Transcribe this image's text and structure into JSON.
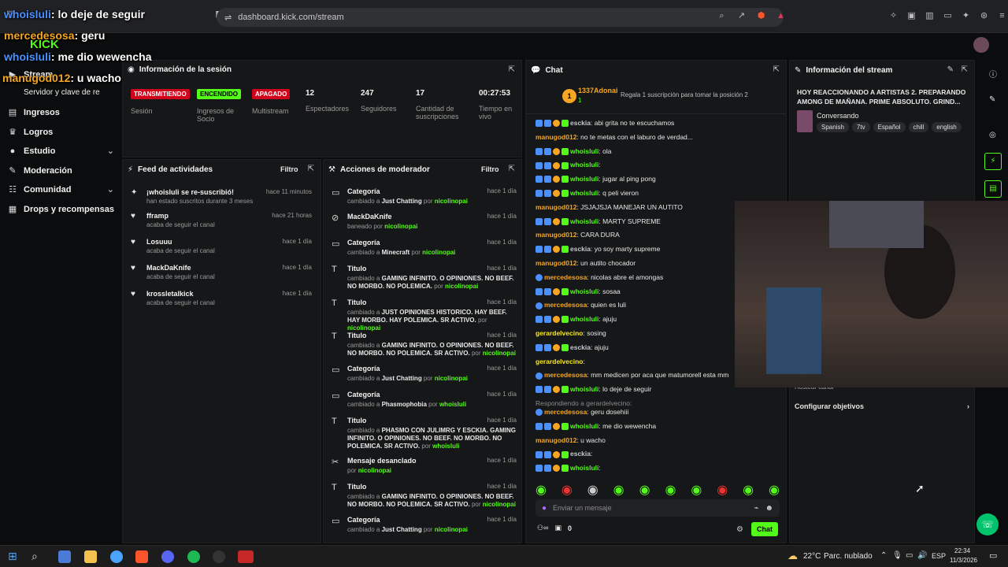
{
  "browser": {
    "url": "dashboard.kick.com/stream"
  },
  "overlay": {
    "lines": [
      {
        "user": "whoisluli",
        "text": ": lo deje de seguir"
      },
      {
        "user": "mercedesosa",
        "text": ": geru"
      },
      {
        "user": "whoisluli",
        "text": ": me dio wewencha"
      },
      {
        "user": "manugod012",
        "text": ": u wacho"
      }
    ],
    "logo": "KICK"
  },
  "nav": {
    "items": [
      {
        "label": "Stream"
      },
      {
        "label": "Servidor y clave de re"
      },
      {
        "label": "Ingresos"
      },
      {
        "label": "Logros"
      },
      {
        "label": "Estudio"
      },
      {
        "label": "Moderación"
      },
      {
        "label": "Comunidad"
      },
      {
        "label": "Drops y recompensas"
      }
    ]
  },
  "session": {
    "title": "Información de la sesión",
    "status": [
      {
        "badge": "TRANSMITIENDO",
        "label": "Sesión",
        "color": "#d0021b"
      },
      {
        "badge": "ENCENDIDO",
        "label": "Ingresos de Socio",
        "color": "#53fc18"
      },
      {
        "badge": "APAGADO",
        "label": "Multistream",
        "color": "#d0021b"
      }
    ],
    "stats": [
      {
        "value": "12",
        "label": "Espectadores"
      },
      {
        "value": "247",
        "label": "Seguidores"
      },
      {
        "value": "17",
        "label": "Cantidad de suscripciones"
      },
      {
        "value": "00:27:53",
        "label": "Tiempo en vivo"
      }
    ]
  },
  "feed": {
    "title": "Feed de actividades",
    "filter": "Filtro",
    "items": [
      {
        "name": "¡whoisluli se re-suscribió!",
        "sub": "han estado suscritos durante 3 meses",
        "time": "hace 11 minutos"
      },
      {
        "name": "fframp",
        "sub": "acaba de seguir el canal",
        "time": "hace 21 horas"
      },
      {
        "name": "Losuuu",
        "sub": "acaba de seguir el canal",
        "time": "hace 1 día"
      },
      {
        "name": "MackDaKnife",
        "sub": "acaba de seguir el canal",
        "time": "hace 1 día"
      },
      {
        "name": "krossletalkick",
        "sub": "acaba de seguir el canal",
        "time": "hace 1 día"
      }
    ]
  },
  "mod": {
    "title": "Acciones de moderador",
    "filter": "Filtro",
    "items": [
      {
        "title": "Categoría",
        "pre": "cambiado a ",
        "val": "Just Chatting",
        "post": " por ",
        "by": "nicolinopai",
        "time": "hace 1 día"
      },
      {
        "title": "MackDaKnife",
        "pre": "baneado por ",
        "val": "",
        "post": "",
        "by": "nicolinopai",
        "time": "hace 1 día"
      },
      {
        "title": "Categoría",
        "pre": "cambiado a ",
        "val": "Minecraft",
        "post": " por ",
        "by": "nicolinopai",
        "time": "hace 1 día"
      },
      {
        "title": "Titulo",
        "pre": "cambiado a ",
        "val": "GAMING INFINITO. O OPINIONES. NO BEEF. NO MORBO. NO POLEMICA.",
        "post": " por ",
        "by": "nicolinopai",
        "time": "hace 1 día"
      },
      {
        "title": "Titulo",
        "pre": "cambiado a ",
        "val": "JUST OPINIONES HISTORICO. HAY BEEF. HAY MORBO. HAY POLEMICA. SR ACTIVO.",
        "post": " por ",
        "by": "nicolinopai",
        "time": "hace 1 día"
      },
      {
        "title": "Titulo",
        "pre": "cambiado a ",
        "val": "GAMING INFINITO. O OPINIONES. NO BEEF. NO MORBO. NO POLEMICA. SR ACTIVO.",
        "post": " por ",
        "by": "nicolinopai",
        "time": "hace 1 día"
      },
      {
        "title": "Categoría",
        "pre": "cambiado a ",
        "val": "Just Chatting",
        "post": " por ",
        "by": "nicolinopai",
        "time": "hace 1 día"
      },
      {
        "title": "Categoría",
        "pre": "cambiado a ",
        "val": "Phasmophobia",
        "post": " por ",
        "by": "whoisluli",
        "time": "hace 1 día"
      },
      {
        "title": "Titulo",
        "pre": "cambiado a ",
        "val": "PHASMO CON JULIMRG Y ESCKIA. GAMING INFINITO. O OPINIONES. NO BEEF. NO MORBO. NO POLEMICA. SR ACTIVO.",
        "post": " por ",
        "by": "whoisluli",
        "time": "hace 1 día"
      },
      {
        "title": "Mensaje desanclado",
        "pre": "por ",
        "val": "",
        "post": "",
        "by": "nicolinopai",
        "time": "hace 1 día"
      },
      {
        "title": "Titulo",
        "pre": "cambiado a ",
        "val": "GAMING INFINITO. O OPINIONES. NO BEEF. NO MORBO. NO POLEMICA. SR ACTIVO.",
        "post": " por ",
        "by": "nicolinopai",
        "time": "hace 1 día"
      },
      {
        "title": "Categoría",
        "pre": "cambiado a ",
        "val": "Just Chatting",
        "post": " por ",
        "by": "nicolinopai",
        "time": "hace 1 día"
      }
    ]
  },
  "chat": {
    "title": "Chat",
    "pinned_user": "1337Adonai",
    "pinned_count": "1",
    "pinned_text": "Regala 1 suscripción para tomar la posición 2",
    "messages": [
      {
        "user": "esckia",
        "color": "gray",
        "text": ": abi grita no te escuchamos"
      },
      {
        "user": "manugod012",
        "color": "orange",
        "text": ": no te metas con el laburo de verdad..."
      },
      {
        "user": "whoisluli",
        "color": "green",
        "text": ": ola"
      },
      {
        "user": "whoisluli",
        "color": "green",
        "text": ":"
      },
      {
        "user": "whoisluli",
        "color": "green",
        "text": ": jugar al ping pong"
      },
      {
        "user": "whoisluli",
        "color": "green",
        "text": ": q peli vieron"
      },
      {
        "user": "manugod012",
        "color": "orange",
        "text": ": JSJAJSJA MANEJAR UN AUTITO"
      },
      {
        "user": "whoisluli",
        "color": "green",
        "text": ": MARTY SUPREME"
      },
      {
        "user": "manugod012",
        "color": "orange",
        "text": ": CARA DURA"
      },
      {
        "user": "esckia",
        "color": "gray",
        "text": ": yo soy marty supreme"
      },
      {
        "user": "manugod012",
        "color": "orange",
        "text": ": un autito chocador"
      },
      {
        "user": "mercedesosa",
        "color": "orange",
        "text": ": nicolas abre el amongas"
      },
      {
        "user": "whoisluli",
        "color": "green",
        "text": ": sosaa"
      },
      {
        "user": "mercedesosa",
        "color": "orange",
        "text": ": quien es luli"
      },
      {
        "user": "whoisluli",
        "color": "green",
        "text": ": ajuju"
      },
      {
        "user": "gerardelvecino",
        "color": "yellow",
        "text": ": sosing"
      },
      {
        "user": "esckia",
        "color": "gray",
        "text": ": ajuju"
      },
      {
        "user": "gerardelvecino",
        "color": "yellow",
        "text": ":"
      },
      {
        "user": "mercedesosa",
        "color": "orange",
        "text": ": mm medicen por aca que matumorell esta mm"
      },
      {
        "user": "whoisluli",
        "color": "green",
        "text": ": lo deje de seguir"
      },
      {
        "user": "mercedesosa",
        "color": "orange",
        "text": ": geru dosehiii"
      },
      {
        "user": "whoisluli",
        "color": "green",
        "text": ": me dio wewencha"
      },
      {
        "user": "manugod012",
        "color": "orange",
        "text": ": u wacho"
      },
      {
        "user": "esckia",
        "color": "gray",
        "text": ":"
      },
      {
        "user": "whoisluli",
        "color": "green",
        "text": ":"
      }
    ],
    "reply_hint": "Respondiendo a gerardelvecino:",
    "input_placeholder": "Enviar un mensaje",
    "points": "0",
    "send_label": "Chat"
  },
  "stream_info": {
    "title_label": "Información del stream",
    "stream_title": "HOY REACCIONANDO A ARTISTAS 2. PREPARANDO AMONG DE MAÑANA. PRIME ABSOLUTO. GRIND...",
    "category": "Conversando",
    "tags": [
      "Spanish",
      "7tv",
      "Español",
      "chill",
      "english"
    ],
    "host_label": "Hostear canal",
    "goals_label": "Configurar objetivos"
  },
  "taskbar": {
    "weather": "22°C",
    "weather_desc": "Parc. nublado",
    "lang": "ESP",
    "time": "22:34",
    "date": "11/3/2026"
  }
}
